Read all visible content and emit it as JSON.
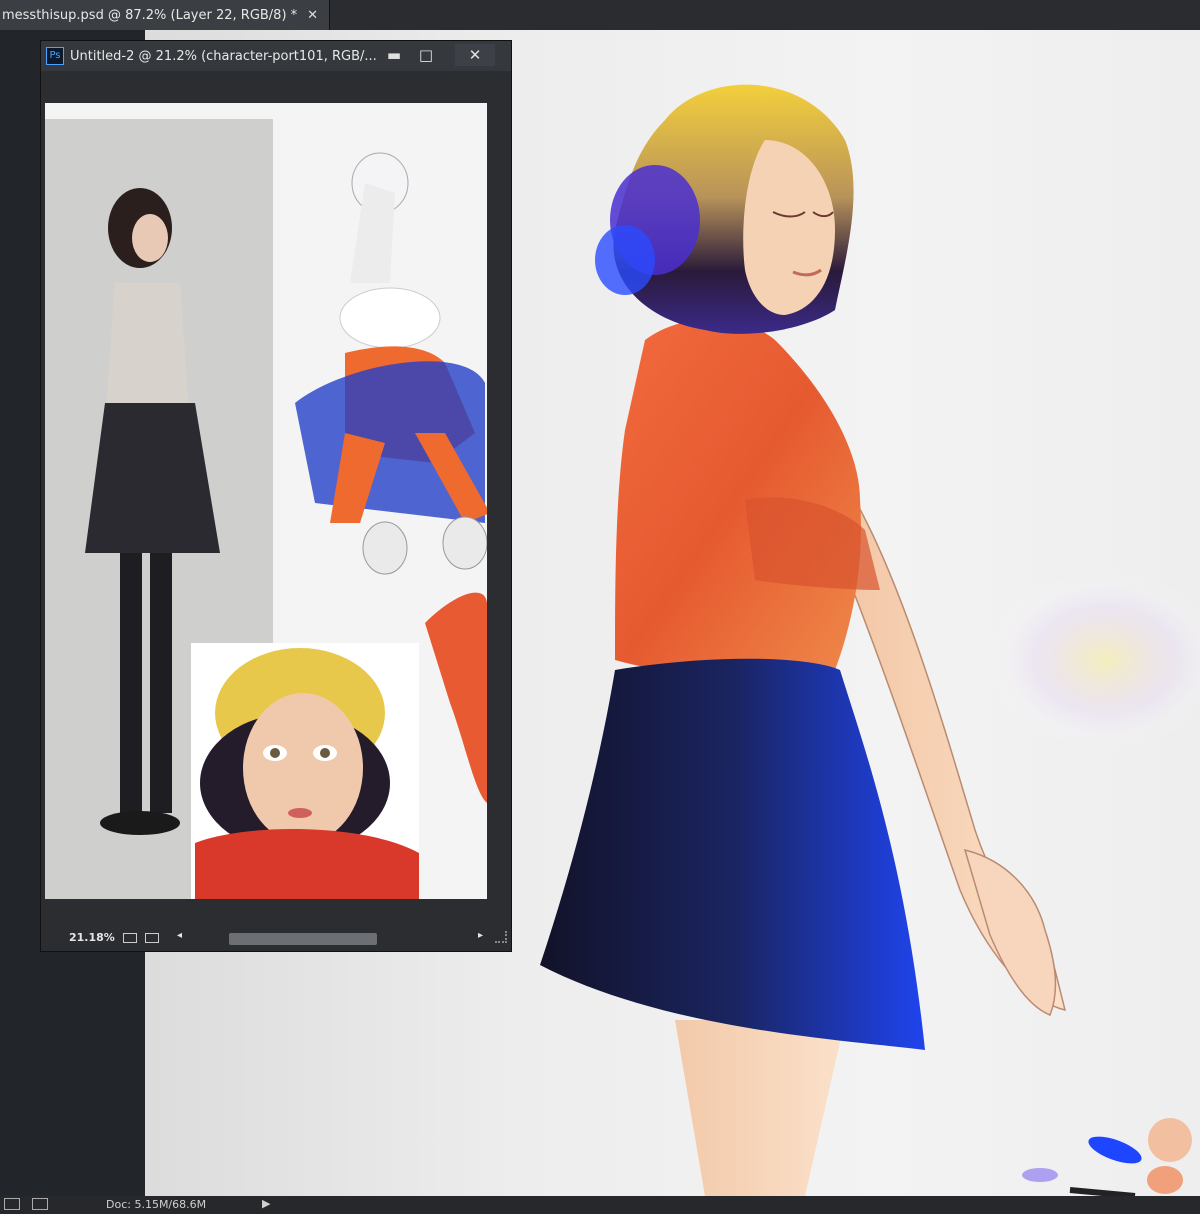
{
  "main_tab": {
    "title": "messthisup.psd @ 87.2% (Layer 22, RGB/8) *",
    "close_glyph": "✕"
  },
  "float_window": {
    "app_icon_label": "Ps",
    "title": "Untitled-2 @ 21.2% (character-port101, RGB/...",
    "minimize_glyph": "▬",
    "maximize_glyph": "□",
    "close_glyph": "✕",
    "zoom": "21.18%",
    "scroll_left_glyph": "◂",
    "scroll_right_glyph": "▸"
  },
  "status_bar": {
    "doc_info": "Doc: 5.15M/68.6M",
    "arrow_glyph": "▶"
  },
  "colors": {
    "shirt": "#e85a32",
    "skirt_dark": "#1a1a3a",
    "skirt_blue": "#1e3fe0",
    "hair_yellow": "#f2c83a",
    "hair_purple": "#5a3bd6"
  },
  "icons": [
    "ps-app-icon",
    "minimize-icon",
    "maximize-icon",
    "close-icon",
    "status-panel-icon",
    "status-export-icon",
    "resize-grip-icon"
  ]
}
